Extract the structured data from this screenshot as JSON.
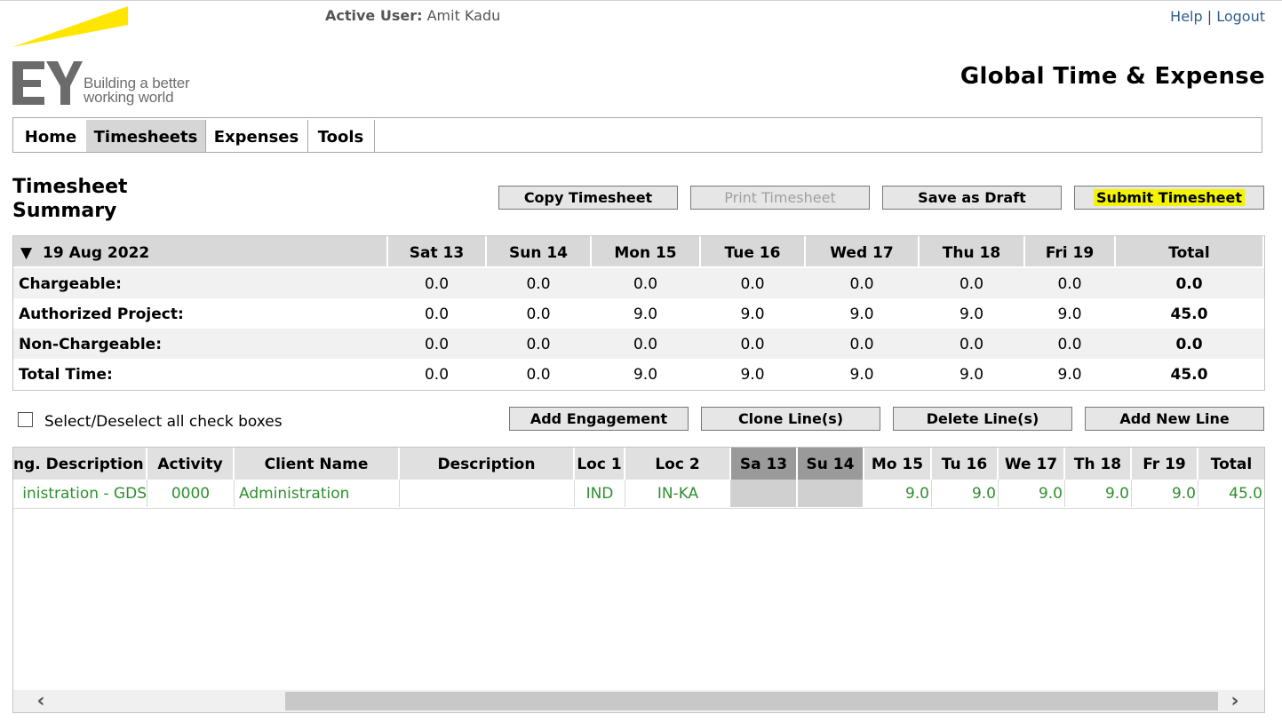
{
  "header": {
    "active_user_label": "Active User:",
    "active_user_name": "Amit Kadu",
    "help_label": "Help",
    "separator": "|",
    "logout_label": "Logout",
    "app_title": "Global Time & Expense",
    "logo": {
      "text": "EY",
      "tagline_line1": "Building a better",
      "tagline_line2": "working world",
      "accent_color": "#FFE600"
    }
  },
  "nav": {
    "items": [
      {
        "label": "Home"
      },
      {
        "label": "Timesheets",
        "active": true
      },
      {
        "label": "Expenses"
      },
      {
        "label": "Tools"
      }
    ]
  },
  "page": {
    "title_line1": "Timesheet",
    "title_line2": "Summary",
    "buttons": {
      "copy": "Copy Timesheet",
      "print": "Print Timesheet",
      "draft": "Save as Draft",
      "submit": "Submit Timesheet"
    }
  },
  "summary": {
    "week_toggle": "▼",
    "week_label": "19 Aug 2022",
    "columns": [
      "Sat 13",
      "Sun 14",
      "Mon 15",
      "Tue 16",
      "Wed 17",
      "Thu 18",
      "Fri 19",
      "Total"
    ],
    "rows": [
      {
        "label": "Chargeable:",
        "values": [
          "0.0",
          "0.0",
          "0.0",
          "0.0",
          "0.0",
          "0.0",
          "0.0",
          "0.0"
        ]
      },
      {
        "label": "Authorized Project:",
        "values": [
          "0.0",
          "0.0",
          "9.0",
          "9.0",
          "9.0",
          "9.0",
          "9.0",
          "45.0"
        ]
      },
      {
        "label": "Non-Chargeable:",
        "values": [
          "0.0",
          "0.0",
          "0.0",
          "0.0",
          "0.0",
          "0.0",
          "0.0",
          "0.0"
        ]
      },
      {
        "label": "Total Time:",
        "values": [
          "0.0",
          "0.0",
          "9.0",
          "9.0",
          "9.0",
          "9.0",
          "9.0",
          "45.0"
        ]
      }
    ]
  },
  "line_actions": {
    "select_all_label": "Select/Deselect all check boxes",
    "add_engagement": "Add Engagement",
    "clone_lines": "Clone Line(s)",
    "delete_lines": "Delete Line(s)",
    "add_new_line": "Add New Line"
  },
  "lines": {
    "columns": [
      "ng. Description",
      "Activity",
      "Client Name",
      "Description",
      "Loc 1",
      "Loc 2",
      "Sa 13",
      "Su 14",
      "Mo 15",
      "Tu 16",
      "We 17",
      "Th 18",
      "Fr 19",
      "Total"
    ],
    "rows": [
      {
        "eng_description": "inistration - GDS",
        "activity": "0000",
        "client_name": "Administration",
        "description": "",
        "loc1": "IND",
        "loc2": "IN-KA",
        "sa": "",
        "su": "",
        "mo": "9.0",
        "tu": "9.0",
        "we": "9.0",
        "th": "9.0",
        "fr": "9.0",
        "total": "45.0"
      }
    ],
    "scroll_left_icon": "‹",
    "scroll_right_icon": "›"
  },
  "colors": {
    "line_text": "#2f8f2f",
    "highlight": "#f4f400",
    "header_bg": "#d8d8d8",
    "weekend_bg": "#9a9a9a"
  }
}
